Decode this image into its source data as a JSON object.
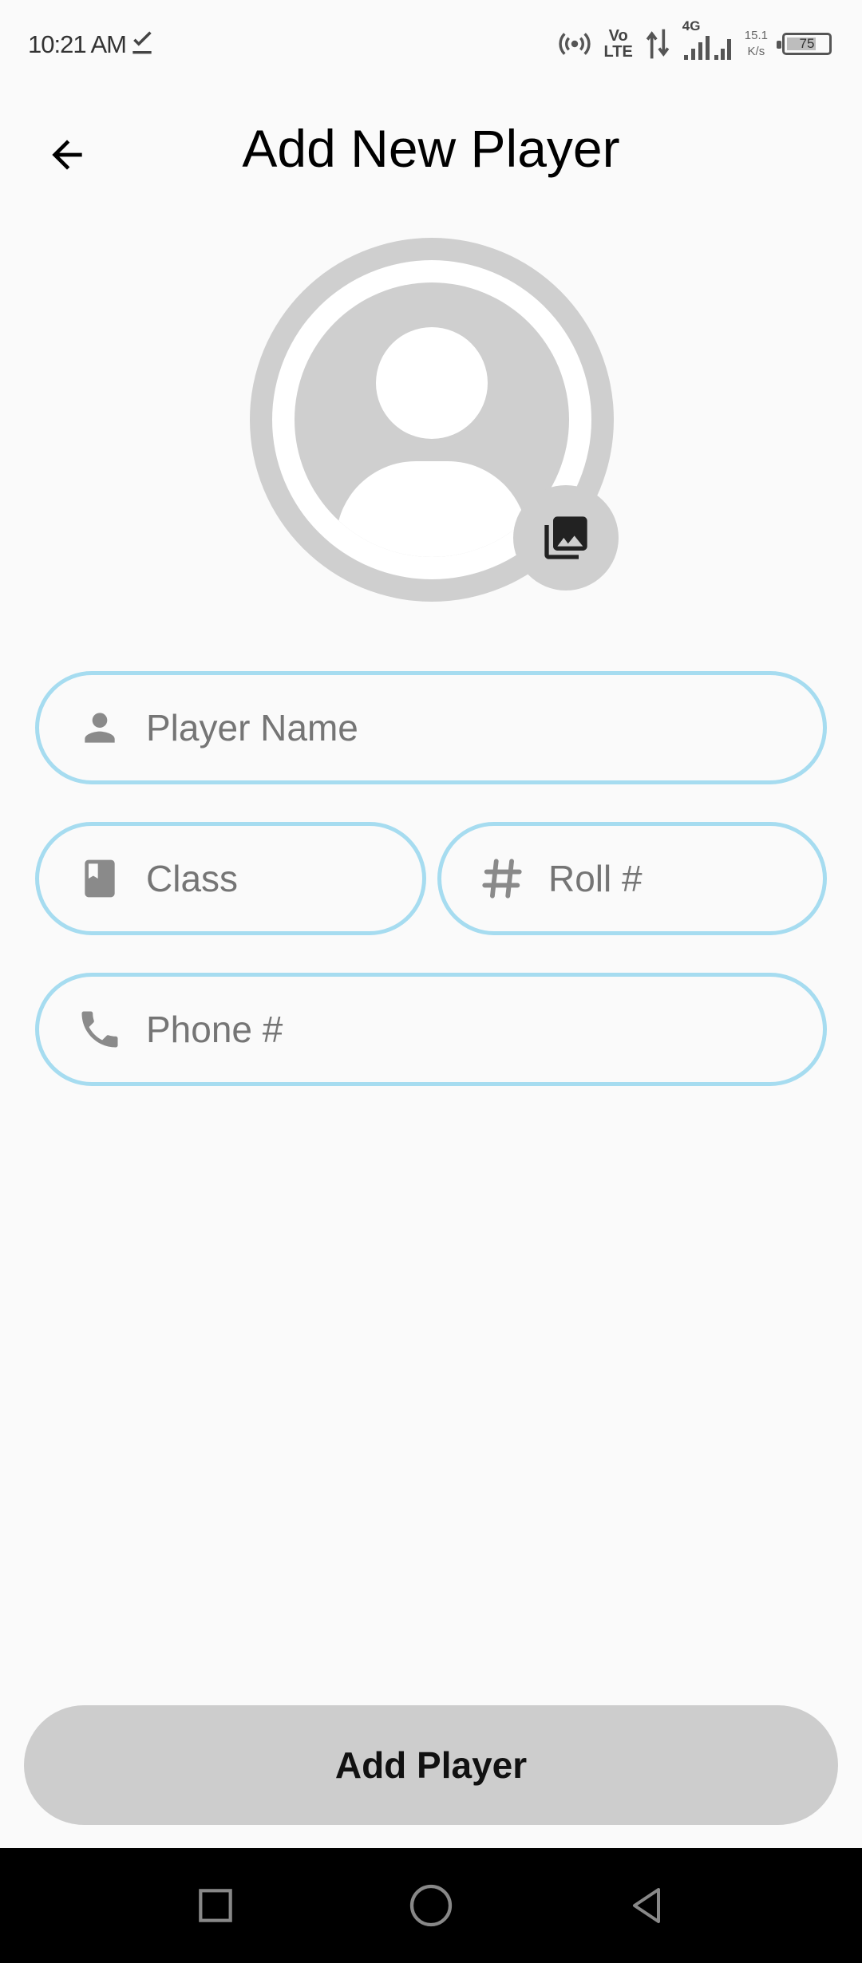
{
  "status_bar": {
    "time": "10:21 AM",
    "volte_top": "Vo",
    "volte_bottom": "LTE",
    "network": "4G",
    "speed_value": "15.1",
    "speed_unit": "K/s",
    "battery": "75",
    "battery_level": 0.75
  },
  "app_bar": {
    "title": "Add New Player"
  },
  "avatar": {
    "icon": "person-icon",
    "action_icon": "photo-library-icon"
  },
  "form": {
    "player_name": {
      "placeholder": "Player Name",
      "value": "",
      "icon": "person-icon"
    },
    "class": {
      "placeholder": "Class",
      "value": "",
      "icon": "class-book-icon"
    },
    "roll": {
      "placeholder": "Roll #",
      "value": "",
      "icon": "hash-icon"
    },
    "phone": {
      "placeholder": "Phone #",
      "value": "",
      "icon": "phone-icon"
    }
  },
  "submit_button": {
    "label": "Add Player"
  },
  "colors": {
    "background": "#fafafa",
    "field_border": "#a6dcf0",
    "avatar_gray": "#cfcfcf",
    "button_gray": "#cdcdcd",
    "icon_gray": "#8a8a8a"
  }
}
